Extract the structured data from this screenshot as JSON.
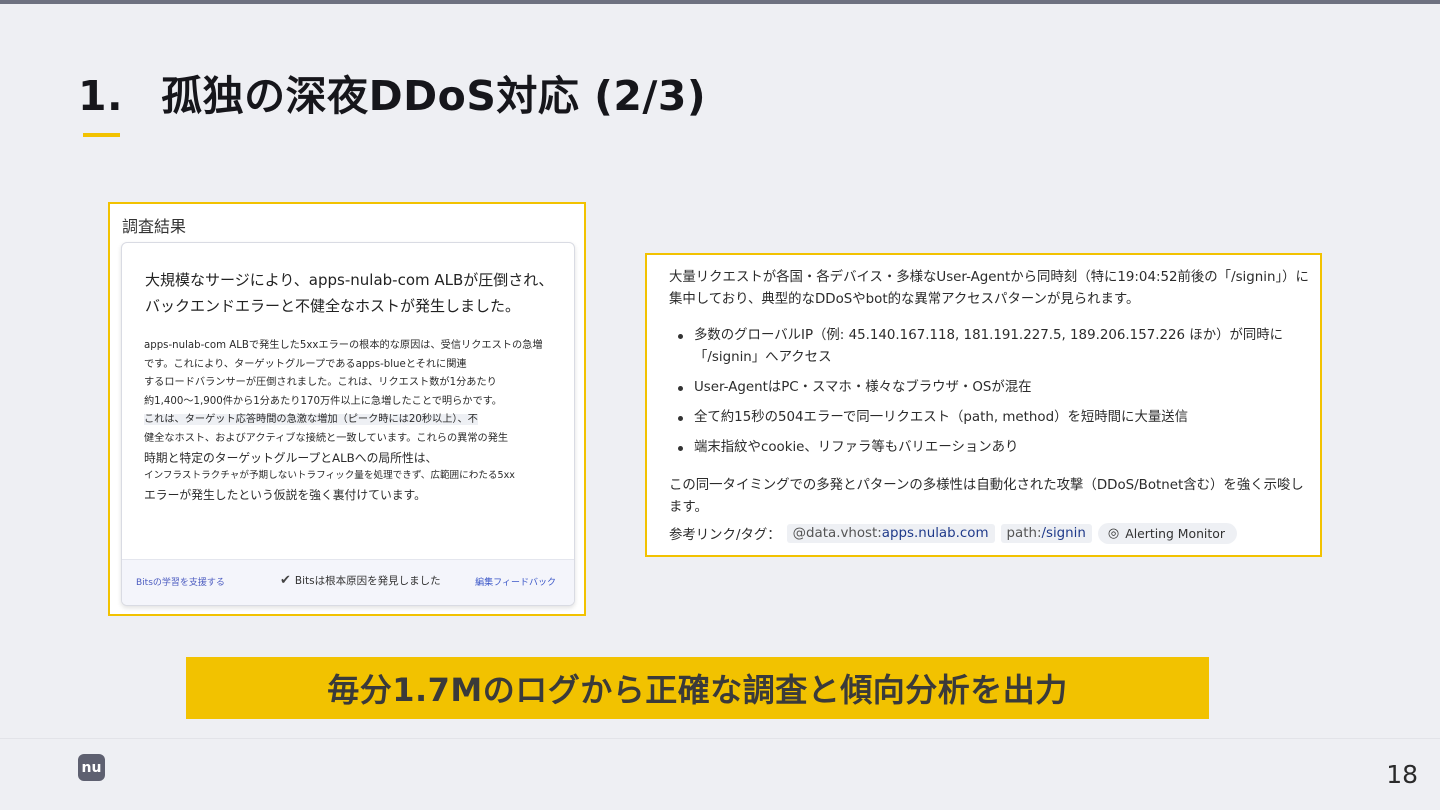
{
  "slide": {
    "title_number": "1.",
    "title_text": "孤独の深夜DDoS対応 (2/3)",
    "page_number": "18",
    "logo_text": "nu"
  },
  "left_panel": {
    "heading": "調査結果",
    "card": {
      "headline": "大規模なサージにより、apps-nulab-com ALBが圧倒され、バックエンドエラーと不健全なホストが発生しました。",
      "body_lines": [
        "apps-nulab-com ALBで発生した5xxエラーの根本的な原因は、受信リクエストの急増",
        "です。これにより、ターゲットグループであるapps-blueとそれに関連",
        "するロードバランサーが圧倒されました。これは、リクエスト数が1分あたり",
        "約1,400〜1,900件から1分あたり170万件以上に急増したことで明らかです。",
        "これは、ターゲット応答時間の急激な増加（ピーク時には20秒以上）、不",
        "健全なホスト、およびアクティブな接続と一致しています。これらの異常の発生",
        "時期と特定のターゲットグループとALBへの局所性は、",
        "インフラストラクチャが予期しないトラフィック量を処理できず、広範囲にわたる5xx",
        "エラーが発生したという仮説を強く裏付けています。"
      ],
      "footer": {
        "learn": "Bitsの学習を支援する",
        "found": "Bitsは根本原因を発見しました",
        "feedback": "編集フィードバック"
      }
    }
  },
  "right_panel": {
    "intro": "大量リクエストが各国・各デバイス・多様なUser-Agentから同時刻（特に19:04:52前後の「/signin」）に集中しており、典型的なDDoSやbot的な異常アクセスパターンが見られます。",
    "bullets": [
      "多数のグローバルIP（例: 45.140.167.118, 181.191.227.5, 189.206.157.226 ほか）が同時に「/signin」へアクセス",
      "User-AgentはPC・スマホ・様々なブラウザ・OSが混在",
      "全て約15秒の504エラーで同一リクエスト（path, method）を短時間に大量送信",
      "端末指紋やcookie、リファラ等もバリエーションあり"
    ],
    "conclusion": "この同一タイミングでの多発とパターンの多様性は自動化された攻撃（DDoS/Botnet含む）を強く示唆します。",
    "tags_label": "参考リンク/タグ：",
    "tag1_key": "@data.vhost:",
    "tag1_value": "apps.nulab.com",
    "tag2_key": "path:",
    "tag2_value": "/signin",
    "pill": "Alerting Monitor"
  },
  "banner": {
    "text": "毎分1.7Mのログから正確な調査と傾向分析を出力"
  },
  "colors": {
    "accent": "#f2c200",
    "background": "#eeeff3",
    "link": "#3b57c8"
  }
}
